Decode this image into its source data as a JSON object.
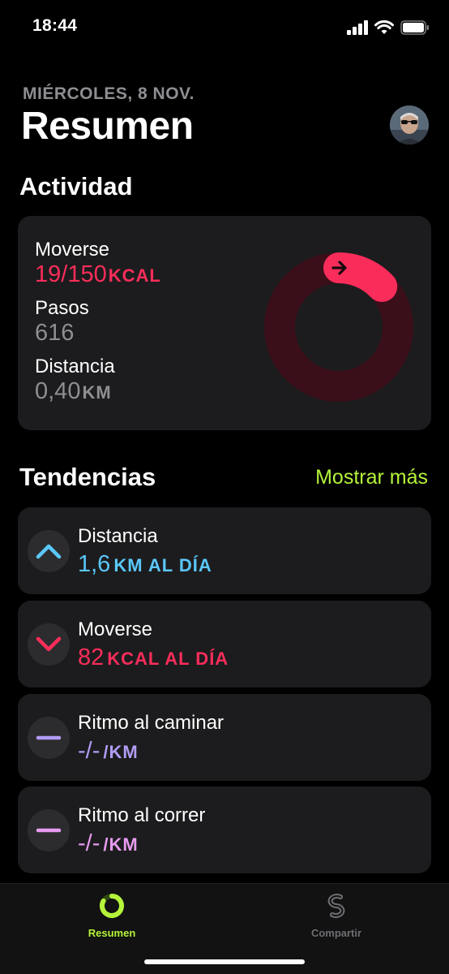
{
  "status_bar": {
    "time": "18:44"
  },
  "header": {
    "date": "MIÉRCOLES, 8 NOV.",
    "title": "Resumen"
  },
  "activity": {
    "section_title": "Actividad",
    "move": {
      "label": "Moverse",
      "value": "19/150",
      "unit": "KCAL",
      "progress_fraction": 0.13
    },
    "steps": {
      "label": "Pasos",
      "value": "616"
    },
    "distance": {
      "label": "Distancia",
      "value": "0,40",
      "unit": "KM"
    }
  },
  "trends": {
    "section_title": "Tendencias",
    "show_more": "Mostrar más",
    "items": [
      {
        "label": "Distancia",
        "value": "1,6",
        "unit": "KM AL DÍA",
        "icon": "chevron-up-icon",
        "color": "#5ac8fa"
      },
      {
        "label": "Moverse",
        "value": "82",
        "unit": "KCAL AL DÍA",
        "icon": "chevron-down-icon",
        "color": "#fa2d5a"
      },
      {
        "label": "Ritmo al caminar",
        "value": "-/-",
        "unit": "/KM",
        "icon": "minus-icon",
        "color": "#b29cf5"
      },
      {
        "label": "Ritmo al correr",
        "value": "-/-",
        "unit": "/KM",
        "icon": "minus-icon",
        "color": "#e79bf0"
      }
    ]
  },
  "tab_bar": {
    "tabs": [
      {
        "label": "Resumen",
        "icon": "activity-ring-icon",
        "active": true,
        "color": "#b5f33a"
      },
      {
        "label": "Compartir",
        "icon": "sharing-icon",
        "active": false,
        "color": "#6e6e73"
      }
    ]
  },
  "colors": {
    "accent": "#b5f33a",
    "move": "#fa2d5a",
    "card": "#1c1c1e"
  }
}
